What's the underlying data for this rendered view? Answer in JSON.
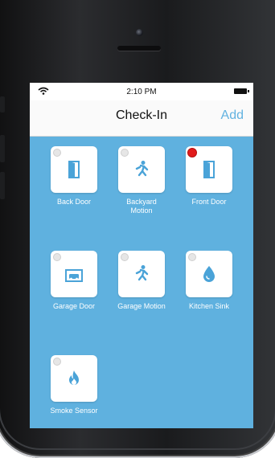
{
  "status": {
    "time": "2:10 PM"
  },
  "nav": {
    "title": "Check-In",
    "add_label": "Add"
  },
  "colors": {
    "accent": "#62b2e0",
    "content_bg": "#5fb1df",
    "icon": "#4aa3d8",
    "alert": "#e11b1b"
  },
  "devices": [
    {
      "label": "Back Door",
      "icon": "door-icon",
      "active": false
    },
    {
      "label": "Backyard\nMotion",
      "icon": "motion-icon",
      "active": false
    },
    {
      "label": "Front Door",
      "icon": "door-icon",
      "active": true
    },
    {
      "label": "Garage Door",
      "icon": "garage-icon",
      "active": false
    },
    {
      "label": "Garage Motion",
      "icon": "motion-icon",
      "active": false
    },
    {
      "label": "Kitchen Sink",
      "icon": "water-drop-icon",
      "active": false
    },
    {
      "label": "Smoke Sensor",
      "icon": "fire-icon",
      "active": false
    }
  ]
}
